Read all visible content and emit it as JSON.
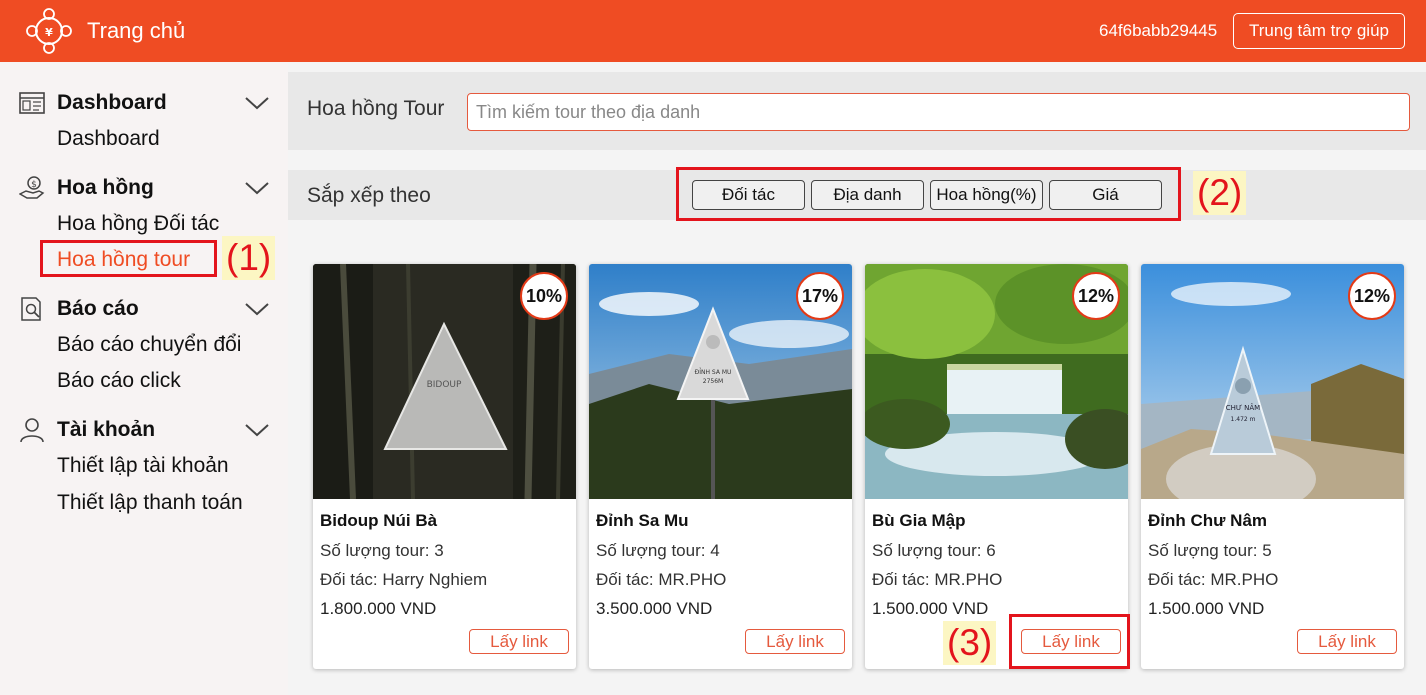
{
  "header": {
    "brand": "Trang chủ",
    "user_id": "64f6babb29445",
    "help_label": "Trung tâm trợ giúp",
    "color": "#ef4c23"
  },
  "sidebar": {
    "sections": [
      {
        "title": "Dashboard",
        "icon": "dashboard-icon",
        "items": [
          "Dashboard"
        ]
      },
      {
        "title": "Hoa hồng",
        "icon": "money-hand-icon",
        "items": [
          "Hoa hồng Đối tác",
          "Hoa hồng tour"
        ]
      },
      {
        "title": "Báo cáo",
        "icon": "report-icon",
        "items": [
          "Báo cáo chuyển đổi",
          "Báo cáo click"
        ]
      },
      {
        "title": "Tài khoản",
        "icon": "user-icon",
        "items": [
          "Thiết lập tài khoản",
          "Thiết lập thanh toán"
        ]
      }
    ],
    "active_item": "Hoa hồng tour"
  },
  "search": {
    "label": "Hoa hồng Tour",
    "placeholder": "Tìm kiếm tour theo địa danh"
  },
  "sort": {
    "label": "Sắp xếp theo",
    "options": [
      "Đối tác",
      "Địa danh",
      "Hoa hồng(%)",
      "Giá"
    ]
  },
  "callouts": [
    "(1)",
    "(2)",
    "(3)"
  ],
  "tours": [
    {
      "name": "Bidoup Núi Bà",
      "count": "Số lượng tour: 3",
      "partner": "Đối tác: Harry Nghiem",
      "price": "1.800.000 VND",
      "commission": "10%",
      "link_label": "Lấy link"
    },
    {
      "name": "Đỉnh Sa Mu",
      "count": "Số lượng tour: 4",
      "partner": "Đối tác: MR.PHO",
      "price": "3.500.000 VND",
      "commission": "17%",
      "link_label": "Lấy link"
    },
    {
      "name": "Bù Gia Mập",
      "count": "Số lượng tour: 6",
      "partner": "Đối tác: MR.PHO",
      "price": "1.500.000 VND",
      "commission": "12%",
      "link_label": "Lấy link"
    },
    {
      "name": "Đỉnh Chư Nâm",
      "count": "Số lượng tour: 5",
      "partner": "Đối tác: MR.PHO",
      "price": "1.500.000 VND",
      "commission": "12%",
      "link_label": "Lấy link"
    }
  ],
  "image_texts": [
    "BIDOUP",
    "ĐỈNH SA MU",
    "2756M",
    "CHƯ NÂM",
    "1.472 m"
  ]
}
